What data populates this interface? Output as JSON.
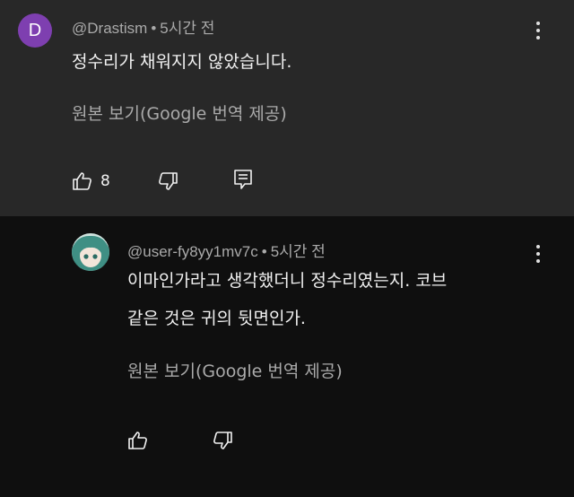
{
  "comment": {
    "avatar_letter": "D",
    "avatar_color": "#7e3fb0",
    "author": "@Drastism",
    "separator": "•",
    "time": "5시간 전",
    "text": "정수리가 채워지지 않았습니다.",
    "translation_link": "원본 보기(Google 번역 제공)",
    "like_count": "8",
    "icons": [
      "thumbs-up-icon",
      "thumbs-down-icon",
      "reply-icon",
      "more-vert-icon"
    ]
  },
  "reply": {
    "author": "@user-fy8yy1mv7c",
    "separator": "•",
    "time": "5시간 전",
    "text_line1": "이마인가라고 생각했더니 정수리였는지. 코브",
    "text_line2": "같은 것은 귀의 뒷면인가.",
    "translation_link": "원본 보기(Google 번역 제공)",
    "icons": [
      "thumbs-up-icon",
      "thumbs-down-icon",
      "more-vert-icon"
    ]
  },
  "colors": {
    "top_background": "#282828",
    "reply_background": "#0f0f0f",
    "primary_text": "#f1f1f1",
    "secondary_text": "#aaaaaa"
  }
}
